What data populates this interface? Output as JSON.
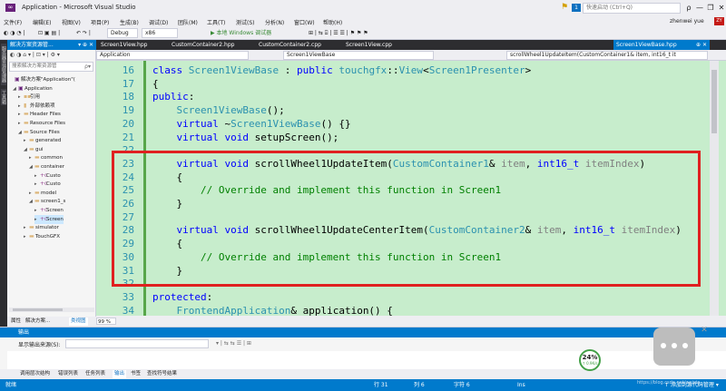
{
  "window": {
    "title": "Application - Microsoft Visual Studio",
    "notify_count": "1",
    "quick_launch_placeholder": "快速启动 (Ctrl+Q)",
    "minimize": "—",
    "restore": "❐",
    "close": "✕",
    "pin": "ρ"
  },
  "menu": {
    "items": [
      "文件(F)",
      "编辑(E)",
      "视图(V)",
      "项目(P)",
      "生成(B)",
      "调试(D)",
      "团队(M)",
      "工具(T)",
      "测试(S)",
      "分析(N)",
      "窗口(W)",
      "帮助(H)"
    ],
    "user": "zhenwei yue",
    "user_badge": "ZY"
  },
  "toolbar": {
    "config": "Debug",
    "platform": "x86",
    "run_label": "▶ 本地 Windows 调试器"
  },
  "side_rail": {
    "tabs": [
      "服务器资源管理器",
      "工具箱"
    ]
  },
  "solution": {
    "header": "解决方案资源管...",
    "header_ctrl": "▾ ⊕ ✕",
    "search_placeholder": "搜索解决方案资源管",
    "search_icon": "ρ▾",
    "tree": [
      {
        "label": "解决方案\"Application\"(",
        "icon": "▣",
        "arrow": ""
      },
      {
        "label": "Application",
        "icon": "▣",
        "arrow": "◢"
      },
      {
        "label": "引用",
        "icon": "▪▪",
        "arrow": "▸"
      },
      {
        "label": "外部依赖项",
        "icon": "▮",
        "arrow": "▸"
      },
      {
        "label": "Header Files",
        "icon": "▬",
        "arrow": "▸"
      },
      {
        "label": "Resource Files",
        "icon": "▬",
        "arrow": "▸"
      },
      {
        "label": "Source Files",
        "icon": "▬",
        "arrow": "◢"
      },
      {
        "label": "generated",
        "icon": "▬",
        "arrow": "▸"
      },
      {
        "label": "gui",
        "icon": "▬",
        "arrow": "◢"
      },
      {
        "label": "common",
        "icon": "▬",
        "arrow": "▸"
      },
      {
        "label": "container",
        "icon": "▬",
        "arrow": "◢"
      },
      {
        "label": "Custo",
        "icon": "+c",
        "arrow": "▸"
      },
      {
        "label": "Custo",
        "icon": "+c",
        "arrow": "▸"
      },
      {
        "label": "model",
        "icon": "▬",
        "arrow": "▸"
      },
      {
        "label": "screen1_s",
        "icon": "▬",
        "arrow": "◢"
      },
      {
        "label": "Screen",
        "icon": "+c",
        "arrow": "▸"
      },
      {
        "label": "Screen",
        "icon": "+c",
        "arrow": "▸"
      },
      {
        "label": "simulator",
        "icon": "▬",
        "arrow": "▸"
      },
      {
        "label": "TouchGFX",
        "icon": "▬",
        "arrow": "▸"
      }
    ],
    "bottom_tabs": [
      "属性",
      "解决方案...",
      "类视图"
    ]
  },
  "editor": {
    "tabs": [
      "Screen1View.hpp",
      "CustomContainer2.hpp",
      "CustomContainer2.cpp",
      "Screen1View.cpp",
      "Screen1ViewBase.hpp"
    ],
    "active_tab_ctrl": "⊕ ✕",
    "nav": [
      "Application",
      "Screen1ViewBase",
      "scrollWheel1UpdateItem(CustomContainer1& item, int16_t it"
    ],
    "zoom": "99 %",
    "lines": [
      {
        "n": "16",
        "parts": [
          [
            "kw",
            "class "
          ],
          [
            "ty",
            "Screen1ViewBase"
          ],
          [
            "fn",
            " : "
          ],
          [
            "kw",
            "public "
          ],
          [
            "ty",
            "touchgfx"
          ],
          [
            "fn",
            "::"
          ],
          [
            "ty",
            "View"
          ],
          [
            "fn",
            "<"
          ],
          [
            "ty",
            "Screen1Presenter"
          ],
          [
            "fn",
            ">"
          ]
        ]
      },
      {
        "n": "17",
        "parts": [
          [
            "fn",
            "{"
          ]
        ]
      },
      {
        "n": "18",
        "parts": [
          [
            "kw",
            "public"
          ],
          [
            "fn",
            ":"
          ]
        ]
      },
      {
        "n": "19",
        "parts": [
          [
            "fn",
            "    "
          ],
          [
            "ty",
            "Screen1ViewBase"
          ],
          [
            "fn",
            "();"
          ]
        ]
      },
      {
        "n": "20",
        "parts": [
          [
            "fn",
            "    "
          ],
          [
            "kw",
            "virtual "
          ],
          [
            "fn",
            "~"
          ],
          [
            "ty",
            "Screen1ViewBase"
          ],
          [
            "fn",
            "() {}"
          ]
        ]
      },
      {
        "n": "21",
        "parts": [
          [
            "fn",
            "    "
          ],
          [
            "kw",
            "virtual void "
          ],
          [
            "fn",
            "setupScreen();"
          ]
        ]
      },
      {
        "n": "22",
        "parts": []
      },
      {
        "n": "23",
        "parts": [
          [
            "fn",
            "    "
          ],
          [
            "kw",
            "virtual void "
          ],
          [
            "fn",
            "scrollWheel1UpdateItem("
          ],
          [
            "ty",
            "CustomContainer1"
          ],
          [
            "fn",
            "& "
          ],
          [
            "pm",
            "item"
          ],
          [
            "fn",
            ", "
          ],
          [
            "kw",
            "int16_t "
          ],
          [
            "pm",
            "itemIndex"
          ],
          [
            "fn",
            ")"
          ]
        ]
      },
      {
        "n": "24",
        "parts": [
          [
            "fn",
            "    {"
          ]
        ]
      },
      {
        "n": "25",
        "parts": [
          [
            "fn",
            "        "
          ],
          [
            "cm",
            "// Override and implement this function in Screen1"
          ]
        ]
      },
      {
        "n": "26",
        "parts": [
          [
            "fn",
            "    }"
          ]
        ]
      },
      {
        "n": "27",
        "parts": []
      },
      {
        "n": "28",
        "parts": [
          [
            "fn",
            "    "
          ],
          [
            "kw",
            "virtual void "
          ],
          [
            "fn",
            "scrollWheel1UpdateCenterItem("
          ],
          [
            "ty",
            "CustomContainer2"
          ],
          [
            "fn",
            "& "
          ],
          [
            "pm",
            "item"
          ],
          [
            "fn",
            ", "
          ],
          [
            "kw",
            "int16_t "
          ],
          [
            "pm",
            "itemIndex"
          ],
          [
            "fn",
            ")"
          ]
        ]
      },
      {
        "n": "29",
        "parts": [
          [
            "fn",
            "    {"
          ]
        ]
      },
      {
        "n": "30",
        "parts": [
          [
            "fn",
            "        "
          ],
          [
            "cm",
            "// Override and implement this function in Screen1"
          ]
        ]
      },
      {
        "n": "31",
        "parts": [
          [
            "fn",
            "    }"
          ]
        ]
      },
      {
        "n": "32",
        "parts": []
      },
      {
        "n": "33",
        "parts": [
          [
            "kw",
            "protected"
          ],
          [
            "fn",
            ":"
          ]
        ]
      },
      {
        "n": "34",
        "parts": [
          [
            "fn",
            "    "
          ],
          [
            "ty",
            "FrontendApplication"
          ],
          [
            "fn",
            "& application() {"
          ]
        ]
      }
    ]
  },
  "output": {
    "header": "输出",
    "source_label": "显示输出来源(S):",
    "tools": "▾ | ⇆ ⇆ ☰ | ⊞"
  },
  "bottom_tabs": [
    "调用层次结构",
    "错误列表",
    "任务列表",
    "输出",
    "书签",
    "查找符号结果"
  ],
  "status": {
    "ready": "就绪",
    "row": "行 31",
    "col": "列 6",
    "char": "字符 6",
    "ins": "Ins",
    "publish": "↑ 添加到源代码管理 ▾"
  },
  "perf": {
    "percent": "24%",
    "sub": "↑ 0.9K/s"
  },
  "watermark": "https://blog.csdn.net/weixin_..."
}
